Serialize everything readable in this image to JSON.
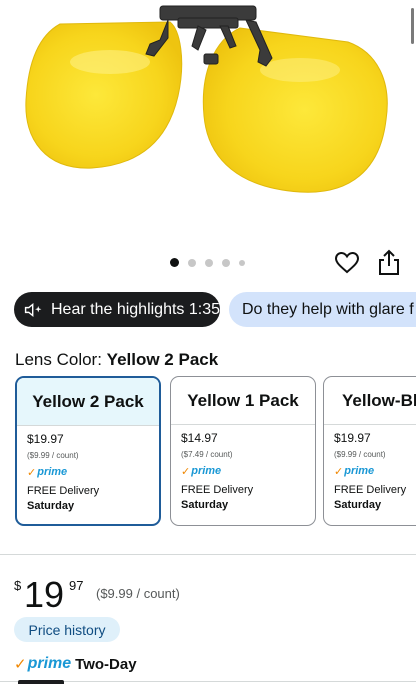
{
  "product_image": {
    "alt": "yellow-clip-on-sunglasses"
  },
  "carousel": {
    "dots": 5,
    "active_index": 0
  },
  "chips": [
    {
      "label": "Hear the highlights 1:35"
    },
    {
      "label": "Do they help with glare f"
    }
  ],
  "lens_color": {
    "label": "Lens Color: ",
    "value": "Yellow 2 Pack"
  },
  "options": [
    {
      "name": "Yellow 2 Pack",
      "price": "$19.97",
      "unit": "($9.99 / count)",
      "prime": "prime",
      "delivery": "FREE Delivery",
      "day": "Saturday",
      "selected": true
    },
    {
      "name": "Yellow 1 Pack",
      "price": "$14.97",
      "unit": "($7.49 / count)",
      "prime": "prime",
      "delivery": "FREE Delivery",
      "day": "Saturday",
      "selected": false
    },
    {
      "name": "Yellow-Bl",
      "price": "$19.97",
      "unit": "($9.99 / count)",
      "prime": "prime",
      "delivery": "FREE Delivery",
      "day": "Saturday",
      "selected": false
    }
  ],
  "price": {
    "currency": "$",
    "whole": "19",
    "fraction": "97",
    "per_unit": "($9.99 / count)"
  },
  "price_history": "Price history",
  "shipping": {
    "check": "✓",
    "prime": "prime",
    "speed": "Two-Day"
  },
  "colors": {
    "accent_blue": "#1f5c99",
    "prime_blue": "#1a98d5",
    "prime_orange": "#f08804",
    "chip_dark": "#1b1c1e",
    "chip_light": "#d3e3fb"
  }
}
